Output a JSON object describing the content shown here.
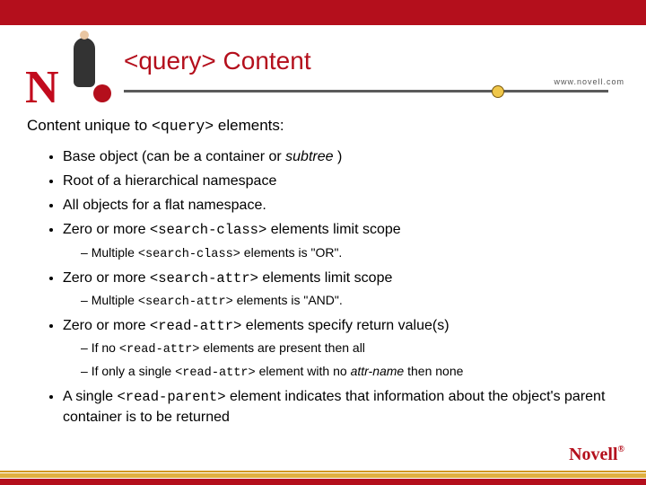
{
  "header": {
    "title_prefix_code": "<query>",
    "title_suffix": " Content",
    "www": "www.novell.com"
  },
  "logo": {
    "letter": "N",
    "footer_text": "Novell"
  },
  "body": {
    "intro_pre": "Content unique to ",
    "intro_code": "<query>",
    "intro_post": " elements:",
    "bullets": [
      {
        "text_pre": "Base object (can be a container or ",
        "italic": "subtree",
        "text_post": " )"
      },
      {
        "text_pre": "Root of a hierarchical namespace"
      },
      {
        "text_pre": "All objects for a flat namespace."
      },
      {
        "text_pre": "Zero or more ",
        "code": "<search-class>",
        "text_post": " elements limit scope",
        "sub": [
          {
            "pre": "Multiple ",
            "code": "<search-class>",
            "post": " elements is \"OR\"."
          }
        ]
      },
      {
        "text_pre": "Zero or more ",
        "code": "<search-attr>",
        "text_post": " elements limit scope",
        "sub": [
          {
            "pre": "Multiple ",
            "code": "<search-attr>",
            "post": " elements is \"AND\"."
          }
        ]
      },
      {
        "text_pre": "Zero or more ",
        "code": "<read-attr>",
        "text_post": " elements specify return value(s)",
        "sub": [
          {
            "pre": "If no ",
            "code": "<read-attr>",
            "post": " elements are present then all"
          },
          {
            "pre": "If only a single ",
            "code": "<read-attr>",
            "post": " element with no ",
            "italic": "attr-name",
            "post2": " then none"
          }
        ]
      },
      {
        "text_pre": "A single ",
        "code": "<read-parent>",
        "text_post": " element indicates that information about the object's parent container is to be returned"
      }
    ]
  }
}
